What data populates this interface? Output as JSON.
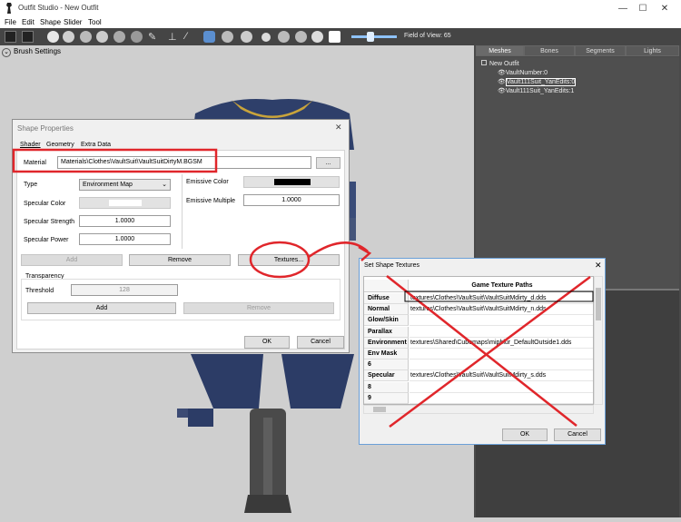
{
  "window": {
    "title": "Outfit Studio - New Outfit",
    "controls": [
      "—",
      "☐",
      "✕"
    ]
  },
  "menu": [
    "File",
    "Edit",
    "Shape",
    "Slider",
    "Tool"
  ],
  "toolbar": {
    "fov_label": "Field of View: 65"
  },
  "viewport": {
    "brush_settings": "Brush Settings"
  },
  "right_panel": {
    "tabs": [
      "Meshes",
      "Bones",
      "Segments",
      "Lights"
    ],
    "tree": {
      "root": "New Outfit",
      "items": [
        "VaultNumber:0",
        "Vault111Suit_YanEdits:0",
        "Vault111Suit_YanEdits:1"
      ]
    }
  },
  "shape_properties": {
    "title": "Shape Properties",
    "close": "✕",
    "tabs": [
      "Shader",
      "Geometry",
      "Extra Data"
    ],
    "material_label": "Material",
    "material_value": "Materials\\Clothes\\VaultSuit\\VaultSuitDirtyM.BGSM",
    "browse": "...",
    "type_label": "Type",
    "type_value": "Environment Map",
    "specular_color_label": "Specular Color",
    "specular_strength_label": "Specular Strength",
    "specular_strength_value": "1.0000",
    "specular_power_label": "Specular Power",
    "specular_power_value": "1.0000",
    "emissive_color_label": "Emissive Color",
    "emissive_multiple_label": "Emissive Multiple",
    "emissive_multiple_value": "1.0000",
    "add": "Add",
    "remove": "Remove",
    "textures": "Textures...",
    "transparency_label": "Transparency",
    "threshold_label": "Threshold",
    "threshold_value": "128",
    "t_add": "Add",
    "t_remove": "Remove",
    "ok": "OK",
    "cancel": "Cancel"
  },
  "set_shape_textures": {
    "title": "Set Shape Textures",
    "close": "✕",
    "header": "Game Texture Paths",
    "rows": [
      {
        "label": "Diffuse",
        "value": "textures\\Clothes\\VaultSuit\\VaultSuitMdirty_d.dds"
      },
      {
        "label": "Normal",
        "value": "textures\\Clothes\\VaultSuit\\VaultSuitMdirty_n.dds"
      },
      {
        "label": "Glow/Skin",
        "value": ""
      },
      {
        "label": "Parallax",
        "value": ""
      },
      {
        "label": "Environment",
        "value": "textures\\Shared\\Cubemaps\\mipblur_DefaultOutside1.dds"
      },
      {
        "label": "Env Mask",
        "value": ""
      },
      {
        "label": "6",
        "value": ""
      },
      {
        "label": "Specular",
        "value": "textures\\Clothes\\VaultSuit\\VaultSuitMdirty_s.dds"
      },
      {
        "label": "8",
        "value": ""
      },
      {
        "label": "9",
        "value": ""
      }
    ],
    "ok": "OK",
    "cancel": "Cancel"
  },
  "colors": {
    "annotation_red": "#e0262b",
    "toolbar": "#454545",
    "panel": "#4a4a4a"
  }
}
